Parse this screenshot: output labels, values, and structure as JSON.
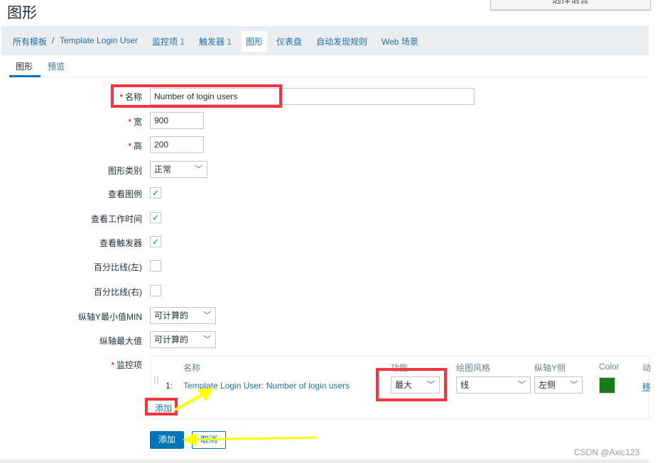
{
  "page": {
    "title": "图形",
    "language_button": "选择语言"
  },
  "nav": {
    "breadcrumb_root": "所有模板",
    "separator": "/",
    "template": "Template Login User",
    "items": {
      "label": "监控项",
      "count": "1"
    },
    "triggers": {
      "label": "触发器",
      "count": "1"
    },
    "graphs": "图形",
    "dashboards": "仪表盘",
    "discovery": "自动发现规则",
    "web": "Web 场景"
  },
  "tabs": [
    {
      "label": "图形",
      "active": true
    },
    {
      "label": "预览",
      "active": false
    }
  ],
  "form": {
    "name": {
      "label": "名称",
      "value": "Number of login users"
    },
    "width": {
      "label": "宽",
      "value": "900"
    },
    "height": {
      "label": "高",
      "value": "200"
    },
    "graph_type": {
      "label": "图形类别",
      "value": "正常"
    },
    "show_legend": {
      "label": "查看图例",
      "checked": true
    },
    "show_working_time": {
      "label": "查看工作时间",
      "checked": true
    },
    "show_triggers": {
      "label": "查看触发器",
      "checked": true
    },
    "percentile_left": {
      "label": "百分比线(左)",
      "checked": false
    },
    "percentile_right": {
      "label": "百分比线(右)",
      "checked": false
    },
    "ymin": {
      "label": "纵轴Y最小值MIN",
      "value": "可计算的"
    },
    "ymax": {
      "label": "纵轴最大值",
      "value": "可计算的"
    },
    "items": {
      "label": "监控项",
      "headers": {
        "name": "名称",
        "function": "功能",
        "draw_style": "绘图风格",
        "y_axis": "纵轴Y侧",
        "color": "Color",
        "action": "动"
      },
      "rows": [
        {
          "index": "1:",
          "name": "Template Login User: Number of login users",
          "function": "最大",
          "draw_style": "线",
          "y_axis": "左侧",
          "color": "#1a7a1a",
          "remove": "移"
        }
      ],
      "add_link": "添加"
    }
  },
  "buttons": {
    "add": "添加",
    "cancel": "取消"
  },
  "watermark": "CSDN @Axic123",
  "colors": {
    "accent": "#0275b8",
    "link": "#1f6fa8",
    "annotation_red": "#f5333f",
    "annotation_arrow": "#ffff00"
  }
}
